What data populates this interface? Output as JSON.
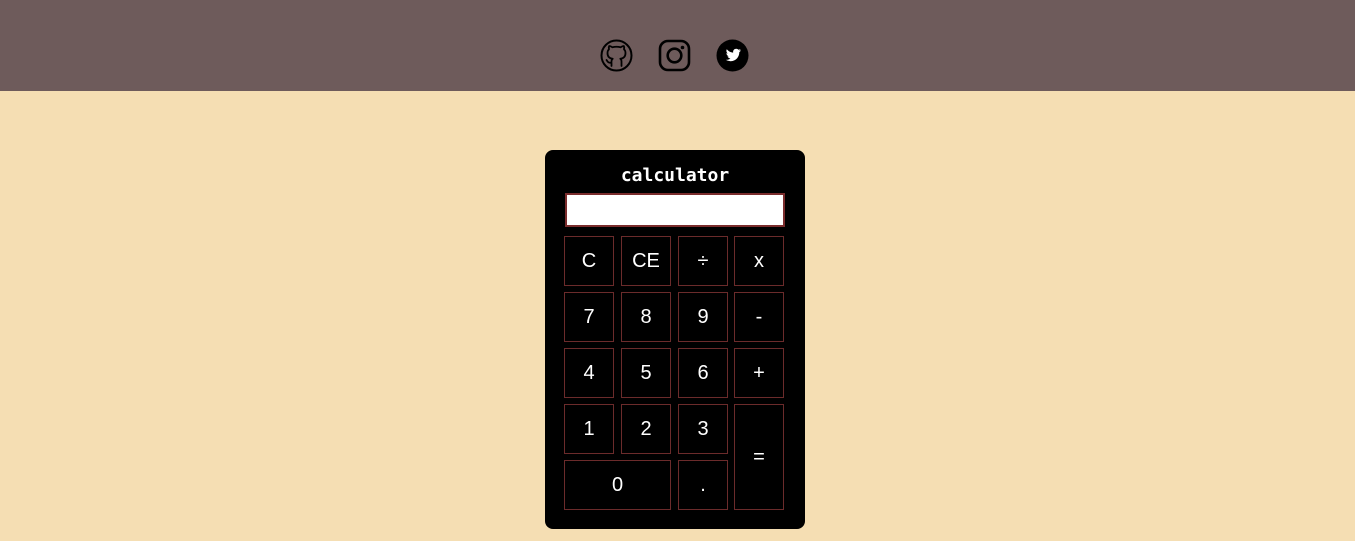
{
  "header": {
    "background": "#6e5b5b",
    "links": [
      {
        "icon": "github-icon"
      },
      {
        "icon": "instagram-icon"
      },
      {
        "icon": "twitter-icon"
      }
    ]
  },
  "page": {
    "background": "#f5deb3"
  },
  "calculator": {
    "title": "calculator",
    "display_value": "",
    "keys": {
      "clear": "C",
      "clear_entry": "CE",
      "divide": "÷",
      "multiply": "x",
      "seven": "7",
      "eight": "8",
      "nine": "9",
      "minus": "-",
      "four": "4",
      "five": "5",
      "six": "6",
      "plus": "+",
      "one": "1",
      "two": "2",
      "three": "3",
      "equals": "=",
      "zero": "0",
      "decimal": "."
    },
    "colors": {
      "body": "#000000",
      "key_border": "#6b2b2b",
      "display_border": "#7a2c2c"
    }
  }
}
